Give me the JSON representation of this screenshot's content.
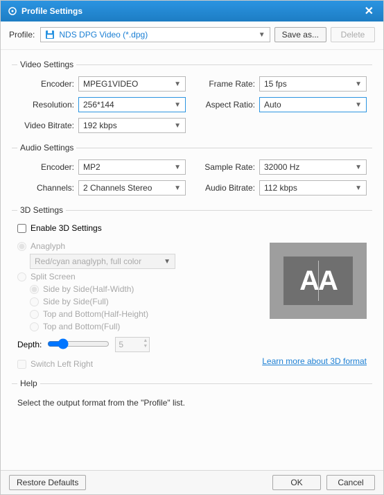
{
  "title": "Profile Settings",
  "profile": {
    "label": "Profile:",
    "value": "NDS DPG Video (*.dpg)",
    "save_as": "Save as...",
    "delete": "Delete"
  },
  "video": {
    "legend": "Video Settings",
    "encoder_label": "Encoder:",
    "encoder": "MPEG1VIDEO",
    "framerate_label": "Frame Rate:",
    "framerate": "15 fps",
    "resolution_label": "Resolution:",
    "resolution": "256*144",
    "aspect_label": "Aspect Ratio:",
    "aspect": "Auto",
    "bitrate_label": "Video Bitrate:",
    "bitrate": "192 kbps"
  },
  "audio": {
    "legend": "Audio Settings",
    "encoder_label": "Encoder:",
    "encoder": "MP2",
    "samplerate_label": "Sample Rate:",
    "samplerate": "32000 Hz",
    "channels_label": "Channels:",
    "channels": "2 Channels Stereo",
    "bitrate_label": "Audio Bitrate:",
    "bitrate": "112 kbps"
  },
  "threeD": {
    "legend": "3D Settings",
    "enable": "Enable 3D Settings",
    "anaglyph": "Anaglyph",
    "anaglyph_mode": "Red/cyan anaglyph, full color",
    "split": "Split Screen",
    "sbs_half": "Side by Side(Half-Width)",
    "sbs_full": "Side by Side(Full)",
    "tb_half": "Top and Bottom(Half-Height)",
    "tb_full": "Top and Bottom(Full)",
    "depth_label": "Depth:",
    "depth_value": "5",
    "switch": "Switch Left Right",
    "preview_text": "AA",
    "learn_more": "Learn more about 3D format"
  },
  "help": {
    "legend": "Help",
    "body": "Select the output format from the \"Profile\" list."
  },
  "footer": {
    "restore": "Restore Defaults",
    "ok": "OK",
    "cancel": "Cancel"
  }
}
